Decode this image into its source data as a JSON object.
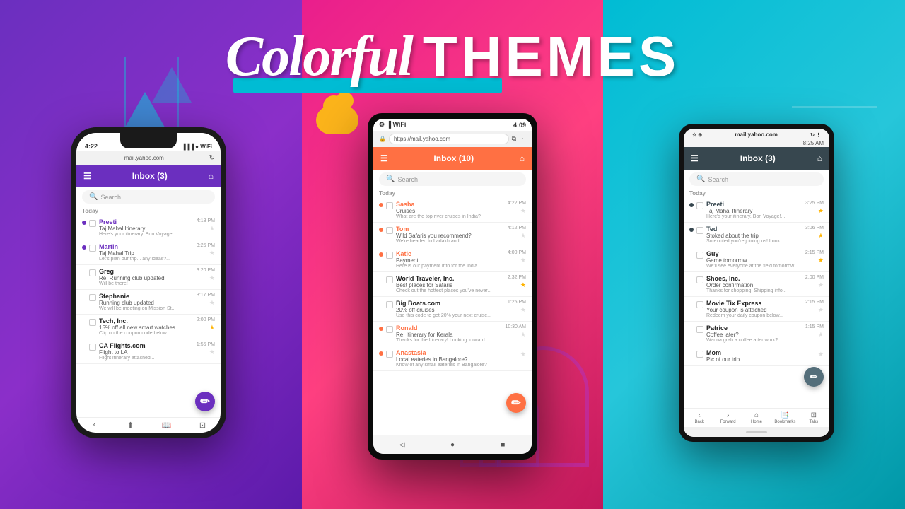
{
  "title": {
    "colorful": "Colorful",
    "themes": "THEMES"
  },
  "left_phone": {
    "status": {
      "time": "4:22",
      "url": "mail.yahoo.com"
    },
    "inbox": "Inbox (3)",
    "search_placeholder": "Search",
    "section": "Today",
    "emails": [
      {
        "sender": "Preeti",
        "time": "4:18 PM",
        "subject": "Taj Mahal Itinerary",
        "preview": "Here's your itinerary. Bon Voyage!...",
        "unread": true,
        "starred": false
      },
      {
        "sender": "Martin",
        "time": "3:25 PM",
        "subject": "Taj Mahal Trip",
        "preview": "Let's plan our trip... any ideas?...",
        "unread": true,
        "starred": false
      },
      {
        "sender": "Greg",
        "time": "3:20 PM",
        "subject": "Re: Running club updated",
        "preview": "Will be there!",
        "unread": false,
        "starred": false
      },
      {
        "sender": "Stephanie",
        "time": "3:17 PM",
        "subject": "Running club updated",
        "preview": "We will be meeting on Mission St...",
        "unread": false,
        "starred": false
      },
      {
        "sender": "Tech, Inc.",
        "time": "2:00 PM",
        "subject": "15% off all new smart watches",
        "preview": "Clip on the coupon code below...",
        "unread": false,
        "starred": true
      },
      {
        "sender": "CA Flights.com",
        "time": "1:55 PM",
        "subject": "Flight to LA",
        "preview": "Flight itinerary attached...",
        "unread": false,
        "starred": false
      }
    ]
  },
  "middle_phone": {
    "status": {
      "time": "4:09",
      "url": "https://mail.yahoo.com"
    },
    "inbox": "Inbox (10)",
    "search_placeholder": "Search",
    "section": "Today",
    "emails": [
      {
        "sender": "Sasha",
        "time": "4:22 PM",
        "subject": "Cruises",
        "preview": "What are the top river cruises in India?",
        "unread": true,
        "starred": false
      },
      {
        "sender": "Tom",
        "time": "4:12 PM",
        "subject": "Wild Safaris you recommend?",
        "preview": "We're headed to Ladakh and...",
        "unread": true,
        "starred": false
      },
      {
        "sender": "Katie",
        "time": "4:00 PM",
        "subject": "Payment",
        "preview": "Here is our payment info for the India...",
        "unread": true,
        "starred": false
      },
      {
        "sender": "World Traveler, Inc.",
        "time": "2:32 PM",
        "subject": "Best places for Safaris",
        "preview": "Check out the hottest places you've never...",
        "unread": false,
        "starred": true
      },
      {
        "sender": "Big Boats.com",
        "time": "1:25 PM",
        "subject": "20% off cruises",
        "preview": "Use this code to get 20% your next cruise...",
        "unread": false,
        "starred": false
      },
      {
        "sender": "Ronald",
        "time": "10:30 AM",
        "subject": "Re: Itinerary for Kerala",
        "preview": "Thanks for the Itinerary! Looking forward...",
        "unread": true,
        "starred": false
      },
      {
        "sender": "Anastasia",
        "time": "",
        "subject": "Local eateries in Bangalore?",
        "preview": "Know of any small eateries in Bangalore?",
        "unread": true,
        "starred": false
      }
    ]
  },
  "right_phone": {
    "status": {
      "time": "8:25 AM",
      "url": "mail.yahoo.com"
    },
    "inbox": "Inbox (3)",
    "search_placeholder": "Search",
    "section": "Today",
    "emails": [
      {
        "sender": "Preeti",
        "time": "3:25 PM",
        "subject": "Taj Mahal Itinerary",
        "preview": "Here's your itinerary. Bon Voyage!...",
        "unread": true,
        "starred": true
      },
      {
        "sender": "Ted",
        "time": "3:06 PM",
        "subject": "Stoked about the trip",
        "preview": "So excited you're joining us! Look...",
        "unread": true,
        "starred": true
      },
      {
        "sender": "Guy",
        "time": "2:15 PM",
        "subject": "Game tomorrow",
        "preview": "We'll see everyone at the field tomorrow at...",
        "unread": false,
        "starred": true
      },
      {
        "sender": "Shoes, Inc.",
        "time": "2:00 PM",
        "subject": "Order confirmation",
        "preview": "Thanks for shopping! Shipping info...",
        "unread": false,
        "starred": false
      },
      {
        "sender": "Movie Tix Express",
        "time": "2:15 PM",
        "subject": "Your coupon is attached",
        "preview": "Redeem your daily coupon below...",
        "unread": false,
        "starred": false
      },
      {
        "sender": "Patrice",
        "time": "1:15 PM",
        "subject": "Coffee later?",
        "preview": "Wanna grab a coffee after work?",
        "unread": false,
        "starred": false
      },
      {
        "sender": "Mom",
        "time": "",
        "subject": "Pic of our trip",
        "preview": "",
        "unread": false,
        "starred": false
      }
    ],
    "bottom_nav": [
      "Back",
      "Forward",
      "Home",
      "Bookmarks",
      "Tabs"
    ]
  }
}
